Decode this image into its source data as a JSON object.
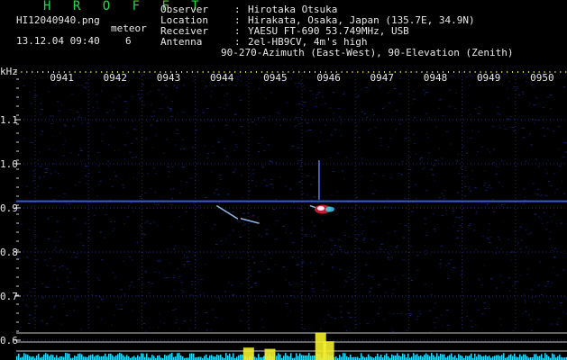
{
  "header": {
    "app_title": "H R O F F T",
    "filename": "HI12040940.png",
    "datetime": "13.12.04 09:40",
    "event_label": "meteor",
    "event_count": "6"
  },
  "meta": [
    {
      "label": "Observer",
      "value": "Hirotaka Otsuka"
    },
    {
      "label": "Location",
      "value": "Hirakata, Osaka, Japan (135.7E, 34.9N)"
    },
    {
      "label": "Receiver",
      "value": "YAESU FT-690 53.749MHz, USB"
    },
    {
      "label": "Antenna",
      "value": "2el-HB9CV, 4m's high"
    },
    {
      "label": "",
      "value": "90-270-Azimuth (East-West), 90-Elevation (Zenith)"
    }
  ],
  "colors": {
    "background": "#000000",
    "text": "#e8e8e8",
    "title": "#23d84a",
    "ticks": "#e8e61e",
    "noise": "#1a2a9a",
    "carrier": "#3f6cff",
    "echo": "#9ec8ff",
    "bottom_bars": "#27d7ff",
    "bottom_peaks": "#f4ee2a"
  },
  "chart_data": {
    "type": "heatmap",
    "ylabel": "kHz",
    "x_ticks": [
      "0941",
      "0942",
      "0943",
      "0944",
      "0945",
      "0946",
      "0947",
      "0948",
      "0949",
      "0950"
    ],
    "y_ticks": [
      "1.1",
      "1.0",
      "0.9",
      "0.8",
      "0.7",
      "0.6"
    ],
    "y_values": [
      1.1,
      1.0,
      0.9,
      0.8,
      0.7,
      0.6
    ],
    "ylim": [
      0.58,
      1.2
    ],
    "xlim": [
      0,
      10
    ],
    "carrier_khz": 0.915,
    "echoes": [
      {
        "x_start": 3.9,
        "x_end": 4.3,
        "khz_start": 0.905,
        "khz_end": 0.875
      },
      {
        "x_start": 4.35,
        "x_end": 4.7,
        "khz_start": 0.876,
        "khz_end": 0.865
      },
      {
        "x_start": 5.65,
        "x_end": 5.9,
        "khz_start": 0.905,
        "khz_end": 0.895
      }
    ],
    "burst": {
      "x": 5.82,
      "khz": 0.897
    },
    "activity_peaks": [
      {
        "x": 4.5,
        "level": 0.35
      },
      {
        "x": 4.9,
        "level": 0.3
      },
      {
        "x": 5.85,
        "level": 0.95
      },
      {
        "x": 6.0,
        "level": 0.6
      }
    ],
    "grid": true
  }
}
